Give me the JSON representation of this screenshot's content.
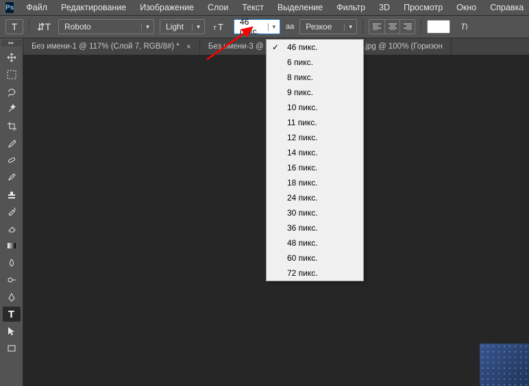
{
  "menubar": {
    "items": [
      "Файл",
      "Редактирование",
      "Изображение",
      "Слои",
      "Текст",
      "Выделение",
      "Фильтр",
      "3D",
      "Просмотр",
      "Окно",
      "Справка"
    ]
  },
  "optbar": {
    "font": "Roboto",
    "weight": "Light",
    "size": "46 пикс.",
    "aa_label": "aa",
    "aa_mode": "Резкое"
  },
  "tabs": [
    {
      "label": "Без имени-1 @ 117% (Слой 7, RGB/8#) *"
    },
    {
      "label": "Без имени-3 @"
    },
    {
      "label": "hdfon.ru-447579140.jpg @ 100% (Горизон"
    }
  ],
  "size_dropdown": {
    "selected": "46 пикс.",
    "options": [
      "46 пикс.",
      "6 пикс.",
      "8 пикс.",
      "9 пикс.",
      "10 пикс.",
      "11 пикс.",
      "12 пикс.",
      "14 пикс.",
      "16 пикс.",
      "18 пикс.",
      "24 пикс.",
      "30 пикс.",
      "36 пикс.",
      "48 пикс.",
      "60 пикс.",
      "72 пикс."
    ]
  },
  "tools": [
    "move",
    "marquee",
    "lasso",
    "magic-wand",
    "crop",
    "eyedropper",
    "healing",
    "brush",
    "stamp",
    "history-brush",
    "eraser",
    "gradient",
    "blur",
    "dodge",
    "pen",
    "type",
    "path-select",
    "rectangle"
  ],
  "colors": {
    "swatch": "#ffffff",
    "arrow": "#ff0000"
  }
}
